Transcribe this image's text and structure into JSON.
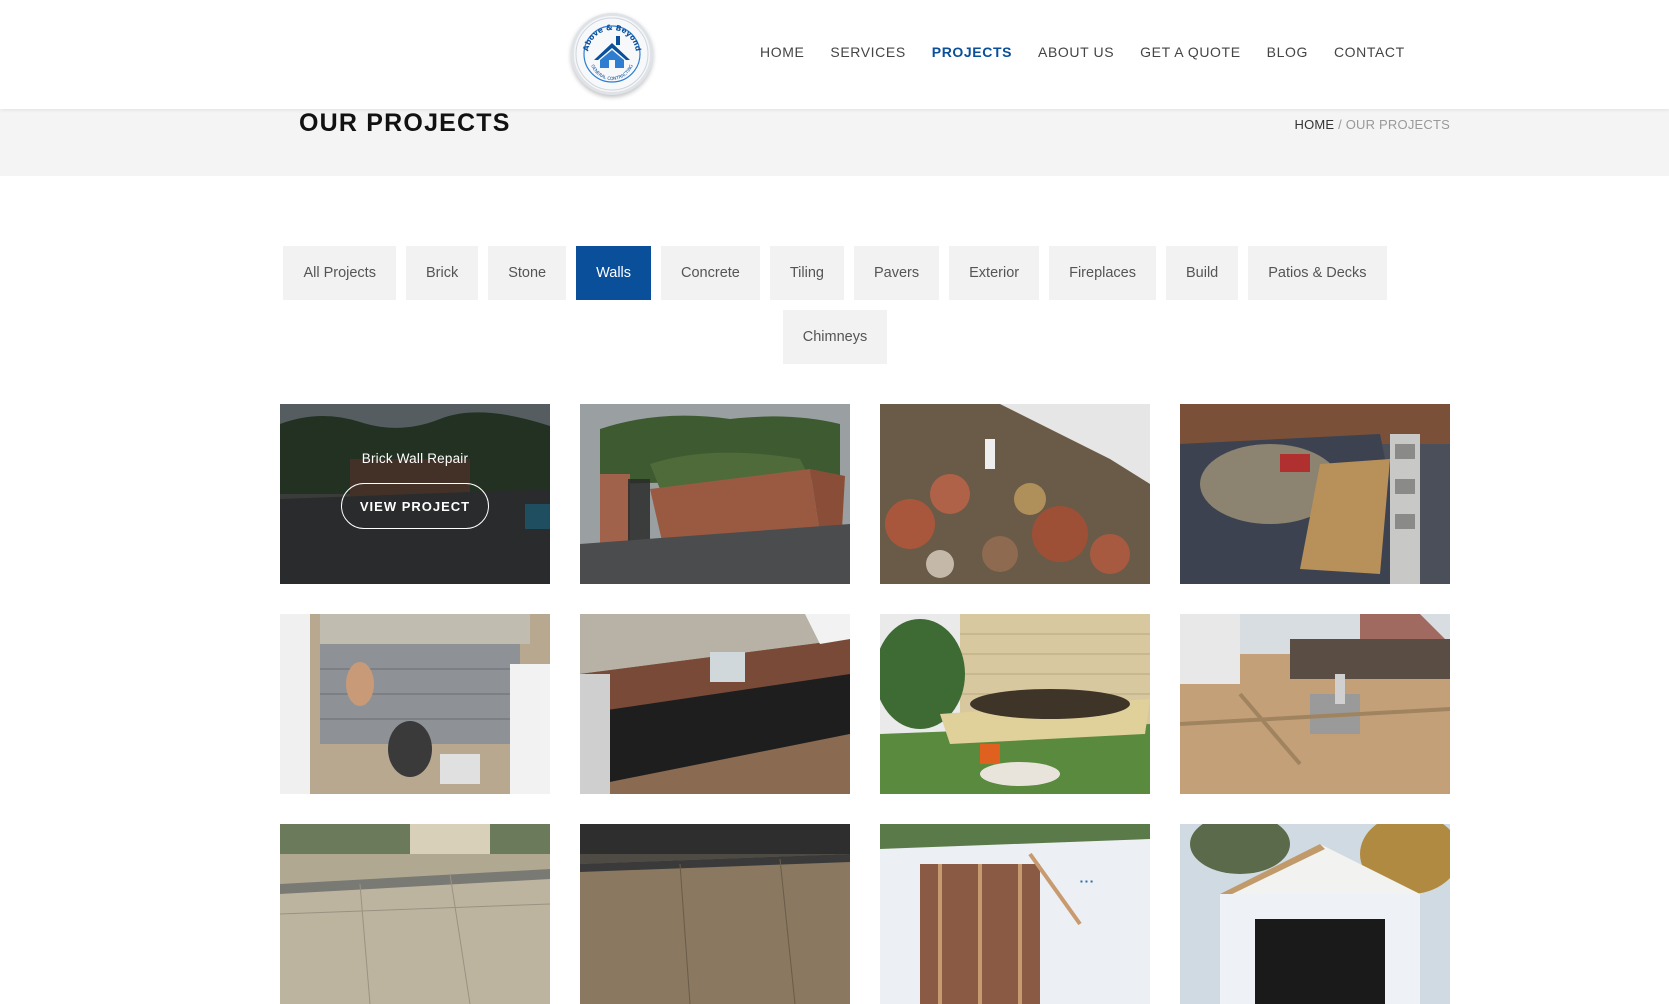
{
  "brand": {
    "logo_top_text": "Above & Beyond",
    "logo_bottom_text": "GENERAL CONTRACTING",
    "colors": {
      "navy": "#0a4f9a",
      "light_blue": "#2e7dd1"
    }
  },
  "nav": {
    "items": [
      {
        "label": "HOME"
      },
      {
        "label": "SERVICES"
      },
      {
        "label": "PROJECTS",
        "active": true
      },
      {
        "label": "ABOUT US"
      },
      {
        "label": "GET A QUOTE"
      },
      {
        "label": "BLOG"
      },
      {
        "label": "CONTACT"
      }
    ]
  },
  "title_bar": {
    "title": "OUR PROJECTS",
    "breadcrumb_home": "HOME",
    "breadcrumb_sep": " / ",
    "breadcrumb_current": "OUR PROJECTS"
  },
  "filters": {
    "items": [
      {
        "label": "All Projects"
      },
      {
        "label": "Brick"
      },
      {
        "label": "Stone"
      },
      {
        "label": "Walls",
        "active": true
      },
      {
        "label": "Concrete"
      },
      {
        "label": "Tiling"
      },
      {
        "label": "Pavers"
      },
      {
        "label": "Exterior"
      },
      {
        "label": "Fireplaces"
      },
      {
        "label": "Build"
      },
      {
        "label": "Patios & Decks"
      },
      {
        "label": "Chimneys"
      }
    ],
    "active_color": "#0a4f9a"
  },
  "projects": {
    "hover_title": "Brick Wall Repair",
    "view_label": "VIEW PROJECT"
  }
}
